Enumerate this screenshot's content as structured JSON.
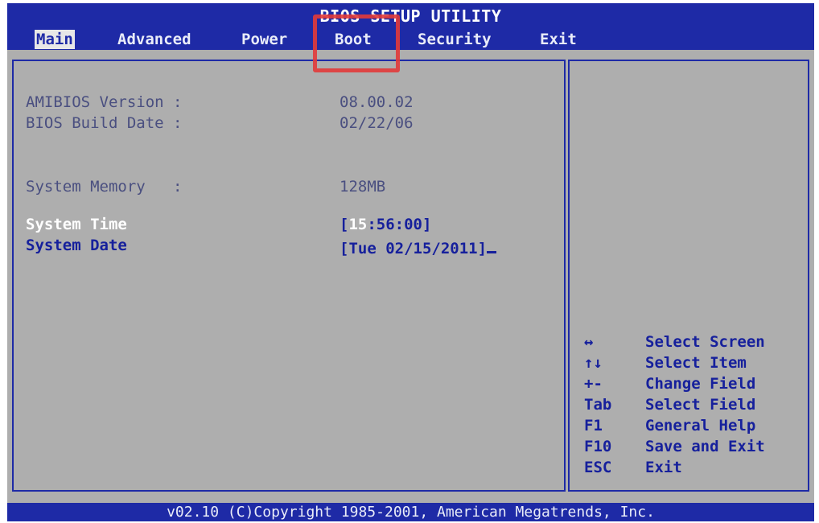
{
  "title": "BIOS SETUP UTILITY",
  "menu": {
    "items": [
      "Main",
      "Advanced",
      "Power",
      "Boot",
      "Security",
      "Exit"
    ]
  },
  "info": {
    "amibios_version_label": "AMIBIOS Version :",
    "amibios_version_value": "08.00.02",
    "bios_build_date_label": "BIOS Build Date :",
    "bios_build_date_value": "02/22/06",
    "system_memory_label": "System Memory   :",
    "system_memory_value": "128MB"
  },
  "settings": {
    "system_time_label": "System Time",
    "system_time_prefix": "[",
    "system_time_hour": "15",
    "system_time_rest": ":56:00]",
    "system_date_label": "System Date",
    "system_date_value": "[Tue 02/15/2011]"
  },
  "help": [
    {
      "key": "↔",
      "desc": "Select Screen"
    },
    {
      "key": "↑↓",
      "desc": "Select Item"
    },
    {
      "key": "+-",
      "desc": "Change Field"
    },
    {
      "key": "Tab",
      "desc": "Select Field"
    },
    {
      "key": "F1",
      "desc": "General Help"
    },
    {
      "key": "F10",
      "desc": "Save and Exit"
    },
    {
      "key": "ESC",
      "desc": "Exit"
    }
  ],
  "footer": "v02.10 (C)Copyright 1985-2001, American Megatrends, Inc."
}
